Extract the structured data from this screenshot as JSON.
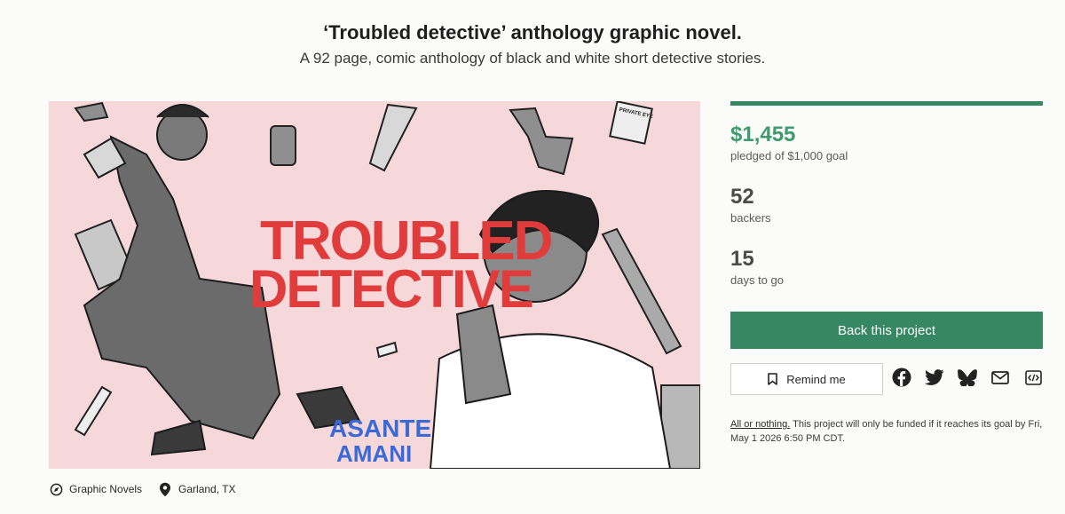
{
  "header": {
    "title": "‘Troubled detective’ anthology graphic novel.",
    "subtitle": "A 92 page, comic anthology of black and white short detective stories."
  },
  "hero": {
    "comic_title_line1": "TROUBLED",
    "comic_title_line2": "DETECTIVE",
    "author_line1": "ASANTE",
    "author_line2": "AMANI",
    "private_eye_label": "PRIVATE EYE"
  },
  "meta": {
    "category": "Graphic Novels",
    "category_icon": "compass-icon",
    "location": "Garland, TX",
    "location_icon": "map-pin-icon"
  },
  "funding": {
    "progress_fraction": 1.0,
    "pledged": "$1,455",
    "pledged_label": "pledged of $1,000 goal",
    "backers": "52",
    "backers_label": "backers",
    "days": "15",
    "days_label": "days to go"
  },
  "actions": {
    "back_label": "Back this project",
    "remind_label": "Remind me"
  },
  "share": [
    "facebook-icon",
    "twitter-icon",
    "bluesky-icon",
    "email-icon",
    "embed-icon"
  ],
  "notice": {
    "link_text": "All or nothing.",
    "text": " This project will only be funded if it reaches its goal by Fri, May 1 2026 6:50 PM CDT."
  },
  "colors": {
    "accent": "#368862",
    "money": "#3f9a6d",
    "hero_bg": "#f6d7da",
    "comic_title": "#e03c3c",
    "author": "#3a6ad8"
  }
}
